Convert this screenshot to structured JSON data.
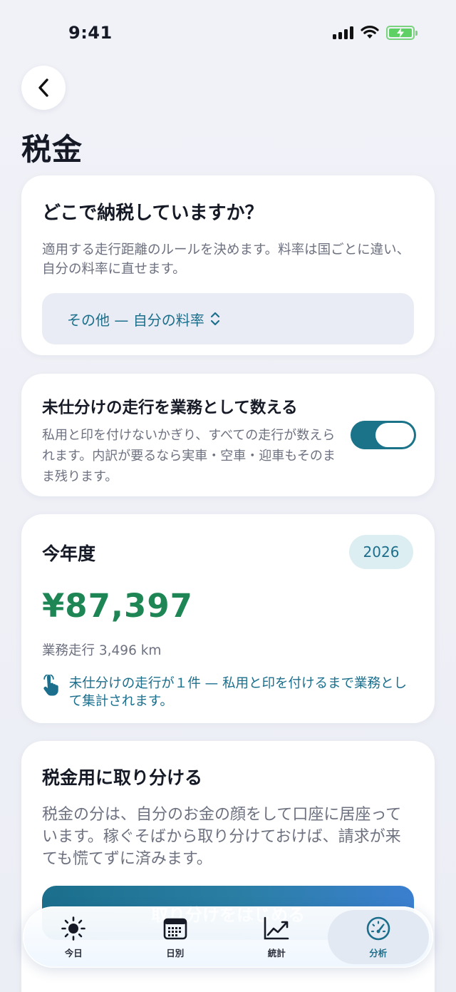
{
  "status_bar": {
    "time": "9:41"
  },
  "page": {
    "title": "税金"
  },
  "location_card": {
    "title": "どこで納税していますか？",
    "description": "適用する走行距離のルールを決めます。料率は国ごとに違い、自分の料率に直せます。",
    "selected_rate": "その他 — 自分の料率"
  },
  "toggle_card": {
    "title": "未仕分けの走行を業務として数える",
    "description": "私用と印を付けないかぎり、すべての走行が数えられます。内訳が要るなら実車・空車・迎車もそのまま残ります。",
    "enabled": true
  },
  "year_card": {
    "title": "今年度",
    "year": "2026",
    "amount": "¥87,397",
    "distance": "業務走行 3,496 km",
    "note": "未仕分けの走行が１件 — 私用と印を付けるまで業務として集計されます。"
  },
  "setaside_card": {
    "title": "税金用に取り分ける",
    "description": "税金の分は、自分のお金の顔をして口座に居座っています。稼ぐそばから取り分けておけば、請求が来ても慌てずに済みます。",
    "button_label": "取り分けをはじめる"
  },
  "tab_bar": {
    "tabs": [
      {
        "label": "今日",
        "icon": "sun-icon"
      },
      {
        "label": "日別",
        "icon": "calendar-icon"
      },
      {
        "label": "統計",
        "icon": "chart-icon"
      },
      {
        "label": "分析",
        "icon": "gauge-icon"
      }
    ],
    "active_index": 3
  },
  "colors": {
    "accent": "#1b6f8c",
    "amount_green": "#1d8654",
    "toggle_on": "#1a7388"
  }
}
